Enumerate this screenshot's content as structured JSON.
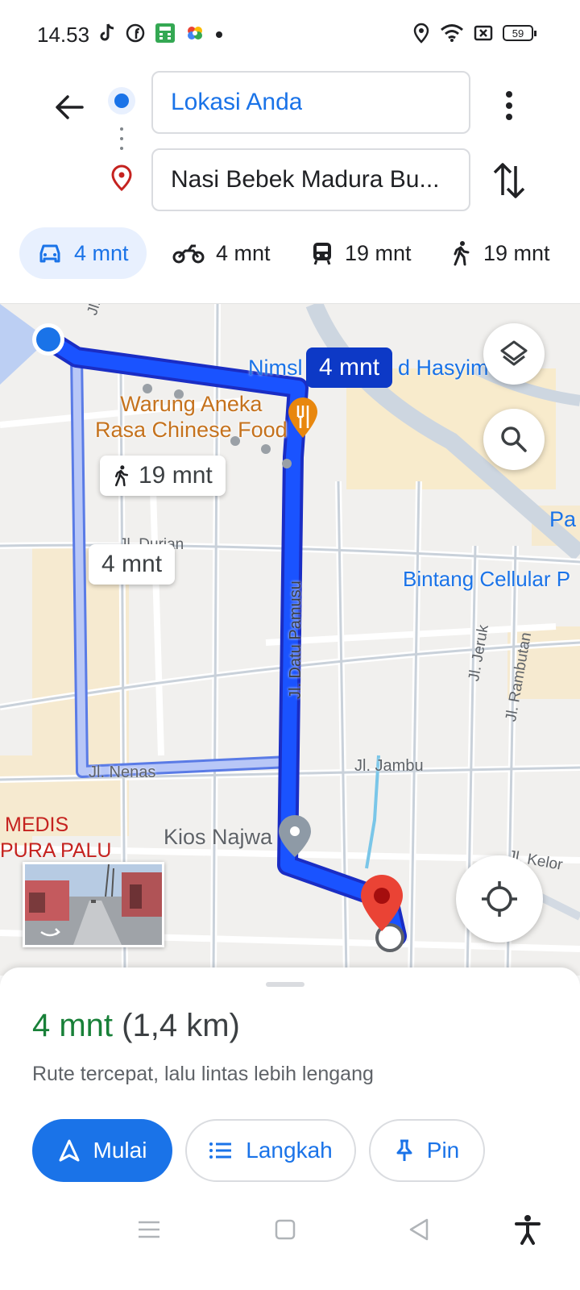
{
  "status_bar": {
    "time": "14.53",
    "battery": "59",
    "left_icons": [
      "tiktok-icon",
      "facebook-icon",
      "calculator-app-icon",
      "photos-app-icon",
      "dot-icon"
    ],
    "right_icons": [
      "location-icon",
      "wifi-icon",
      "no-sim-icon",
      "battery-icon"
    ]
  },
  "directions": {
    "origin": "Lokasi Anda",
    "destination": "Nasi Bebek Madura Bu...",
    "modes": [
      {
        "icon": "car-icon",
        "time": "4 mnt",
        "active": true
      },
      {
        "icon": "motorcycle-icon",
        "time": "4 mnt",
        "active": false
      },
      {
        "icon": "transit-icon",
        "time": "19 mnt",
        "active": false
      },
      {
        "icon": "walk-icon",
        "time": "19 mnt",
        "active": false
      }
    ]
  },
  "map": {
    "route_primary_label": "4 mnt",
    "route_alt_label": "4 mnt",
    "walk_label": "19 mnt",
    "places": {
      "restaurant": "Warung Aneka Rasa Chinese Food",
      "restaurant_line1": "Warung Aneka",
      "restaurant_line2": "Rasa Chinese Food",
      "hasyim_prefix": "Nimsl",
      "hasyim_suffix": "d Hasyim",
      "bintang": "Bintang Cellular P",
      "kios": "Kios Najwa",
      "medis_line1": "MEDIS",
      "medis_line2": "PURA PALU",
      "pa": "Pa"
    },
    "streets": {
      "datu_pamusu": "Jl. Datu Pamusu",
      "nenas": "Jl. Nenas",
      "jambu": "Jl. Jambu",
      "jeruk": "Jl. Jeruk",
      "rambutan": "Jl. Rambutan",
      "kelor": "Jl. Kelor",
      "durian": "Jl. Durian",
      "wr": "Jl. WR"
    },
    "colors": {
      "route": "#1a53ff",
      "route_alt": "#aab9f5",
      "label_primary_bg": "#0d39c6",
      "poi_orange": "#c5721d",
      "poi_blue": "#1a73e8",
      "poi_red": "#c5221f"
    }
  },
  "sheet": {
    "eta_time": "4 mnt",
    "eta_distance": "(1,4 km)",
    "route_description": "Rute tercepat, lalu lintas lebih lengang",
    "btn_start": "Mulai",
    "btn_steps": "Langkah",
    "btn_pin": "Pin"
  },
  "navbar": {
    "icons": [
      "menu-icon",
      "home-icon",
      "back-icon",
      "accessibility-icon"
    ]
  }
}
